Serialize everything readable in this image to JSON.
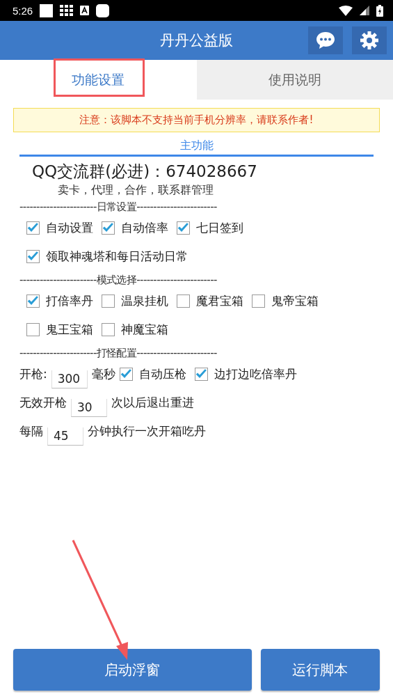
{
  "status_bar": {
    "time": "5:26"
  },
  "app_bar": {
    "title": "丹丹公益版"
  },
  "tabs": [
    {
      "label": "功能设置",
      "selected": true
    },
    {
      "label": "使用说明",
      "selected": false
    }
  ],
  "notice": "注意：该脚本不支持当前手机分辨率，请联系作者!",
  "section_title": "主功能",
  "qq_group": "QQ交流群(必进)：674028667",
  "subtitle": "卖卡，代理，合作，联系群管理",
  "groups": [
    {
      "header": "-----------------------日常设置------------------------",
      "rows": [
        [
          {
            "kind": "checkbox",
            "label": "自动设置",
            "checked": true
          },
          {
            "kind": "checkbox",
            "label": "自动倍率",
            "checked": true
          },
          {
            "kind": "checkbox",
            "label": "七日签到",
            "checked": true
          }
        ],
        [
          {
            "kind": "checkbox",
            "label": "领取神魂塔和每日活动日常",
            "checked": true
          }
        ]
      ]
    },
    {
      "header": "-----------------------模式选择------------------------",
      "rows": [
        [
          {
            "kind": "checkbox",
            "label": "打倍率丹",
            "checked": true
          },
          {
            "kind": "checkbox",
            "label": "温泉挂机",
            "checked": false
          },
          {
            "kind": "checkbox",
            "label": "魔君宝箱",
            "checked": false
          },
          {
            "kind": "checkbox",
            "label": "鬼帝宝箱",
            "checked": false
          }
        ],
        [
          {
            "kind": "checkbox",
            "label": "鬼王宝箱",
            "checked": false
          },
          {
            "kind": "checkbox",
            "label": "神魔宝箱",
            "checked": false
          }
        ]
      ]
    },
    {
      "header": "-----------------------打怪配置------------------------",
      "rows": [
        [
          {
            "kind": "text",
            "text": "开枪:"
          },
          {
            "kind": "input",
            "value": "300"
          },
          {
            "kind": "text",
            "text": "毫秒"
          },
          {
            "kind": "checkbox",
            "label": "自动压枪",
            "checked": true
          },
          {
            "kind": "checkbox",
            "label": "边打边吃倍率丹",
            "checked": true
          }
        ],
        [
          {
            "kind": "text",
            "text": "无效开枪"
          },
          {
            "kind": "input",
            "value": "30"
          },
          {
            "kind": "text",
            "text": "次以后退出重进"
          }
        ],
        [
          {
            "kind": "text",
            "text": "每隔"
          },
          {
            "kind": "input",
            "value": "45"
          },
          {
            "kind": "text",
            "text": "分钟执行一次开箱吃丹"
          }
        ]
      ]
    }
  ],
  "buttons": [
    {
      "label": "启动浮窗"
    },
    {
      "label": "运行脚本"
    }
  ]
}
